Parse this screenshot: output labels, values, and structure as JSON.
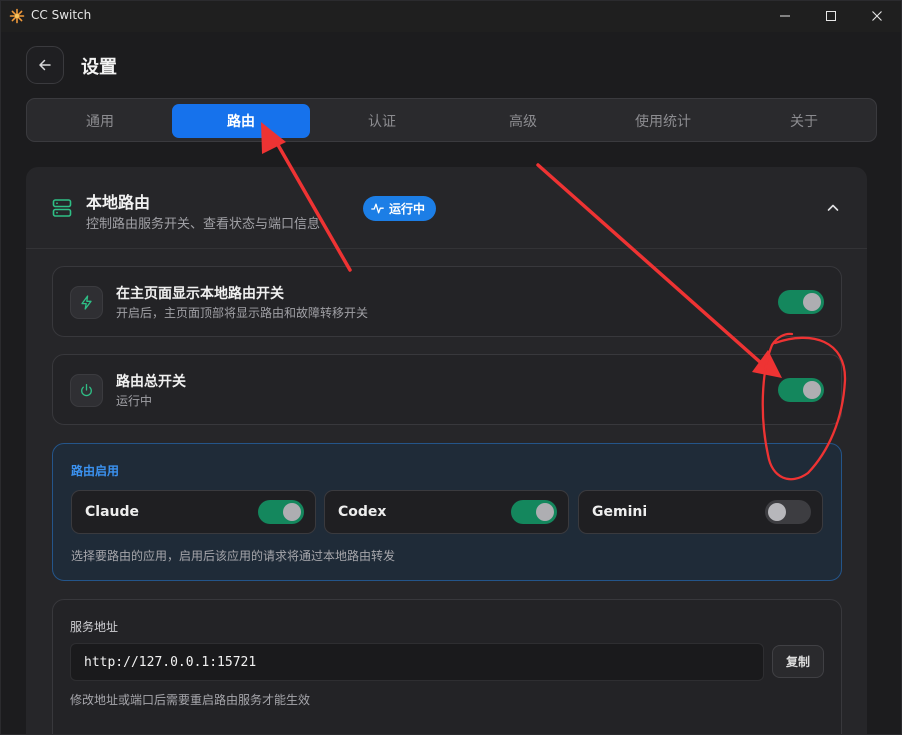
{
  "window": {
    "title": "CC Switch",
    "controls": {
      "minimize": "minimize-icon",
      "maximize": "maximize-icon",
      "close": "close-icon"
    }
  },
  "page": {
    "title": "设置",
    "back_icon": "arrow-left-icon"
  },
  "tabs": [
    {
      "label": "通用"
    },
    {
      "label": "路由",
      "active": true
    },
    {
      "label": "认证"
    },
    {
      "label": "高级"
    },
    {
      "label": "使用统计"
    },
    {
      "label": "关于"
    }
  ],
  "section": {
    "title": "本地路由",
    "subtitle": "控制路由服务开关、查看状态与端口信息",
    "status_badge": "运行中",
    "icon": "server-icon",
    "expanded": true
  },
  "settings": [
    {
      "title": "在主页面显示本地路由开关",
      "subtitle": "开启后，主页面顶部将显示路由和故障转移开关",
      "icon": "lightning-icon",
      "enabled": true
    },
    {
      "title": "路由总开关",
      "subtitle": "运行中",
      "icon": "power-icon",
      "enabled": true
    }
  ],
  "routing": {
    "title": "路由启用",
    "apps": [
      {
        "name": "Claude",
        "enabled": true
      },
      {
        "name": "Codex",
        "enabled": true
      },
      {
        "name": "Gemini",
        "enabled": false
      }
    ],
    "help": "选择要路由的应用，启用后该应用的请求将通过本地路由转发"
  },
  "service": {
    "title": "服务地址",
    "address": "http://127.0.0.1:15721",
    "copy_label": "复制",
    "help": "修改地址或端口后需要重启路由服务才能生效"
  },
  "colors": {
    "accent": "#1672ec",
    "toggle_on": "#14875d",
    "annotation": "#ee3333",
    "routing_border": "#24558a"
  }
}
